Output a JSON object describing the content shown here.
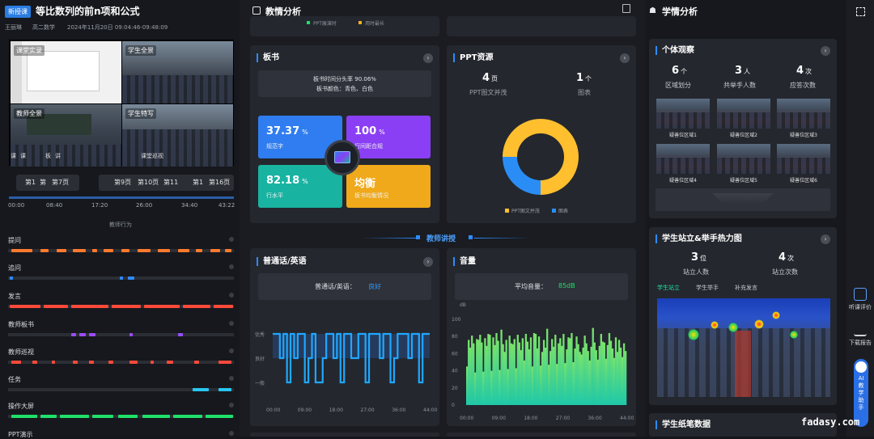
{
  "lesson": {
    "badge": "新授课",
    "title": "等比数列的前n项和公式",
    "teacher": "王丽琳",
    "grade_subject": "高二数学",
    "time": "2024年11月20日 09:04:46-09:48:09"
  },
  "videos": [
    {
      "label": "课堂实录"
    },
    {
      "label": "学生全景"
    },
    {
      "label": "教师全景"
    },
    {
      "label": "学生特写"
    }
  ],
  "video_controls": [
    "课",
    "课",
    "板",
    "讲",
    "课堂巡视"
  ],
  "page_tabs_a": [
    "第1",
    "第",
    "第7页"
  ],
  "page_tabs_b": [
    "第9页",
    "第10页",
    "第11",
    "第1",
    "第16页"
  ],
  "timeline": {
    "ticks": [
      "00:00",
      "08:40",
      "17:20",
      "26:00",
      "34:40",
      "43:22"
    ],
    "caption": "教师行为"
  },
  "behaviors": [
    {
      "label": "提问",
      "color": "#ff7a2e"
    },
    {
      "label": "追问",
      "color": "#2f8bff"
    },
    {
      "label": "发言",
      "color": "#ff4a3a"
    },
    {
      "label": "教师板书",
      "color": "#9b4dff"
    },
    {
      "label": "教师巡视",
      "color": "#ff4a3a"
    },
    {
      "label": "任务",
      "color": "#28c6ef"
    },
    {
      "label": "操作大屏",
      "color": "#1fe06a"
    },
    {
      "label": "PPT演示",
      "color": "#ffb020"
    }
  ],
  "teaching": {
    "header": "教情分析",
    "top_legend": [
      "PPT展演时",
      "用时最长"
    ],
    "board": {
      "title": "板书",
      "coverage_line": "板书时间分头率 90.06%",
      "color_line": "板书颜色：青色、白色",
      "tiles": [
        {
          "value": "37.37",
          "unit": "%",
          "label": "规范字",
          "color": "#2f7df0"
        },
        {
          "value": "100",
          "unit": "%",
          "label": "行间距合规",
          "color": "#8b3ff5"
        },
        {
          "value": "82.18",
          "unit": "%",
          "label": "行水平",
          "color": "#19b3a2"
        },
        {
          "value": "均衡",
          "unit": "",
          "label": "板书均衡情况",
          "color": "#f0a91a"
        }
      ]
    },
    "ppt": {
      "title": "PPT资源",
      "stats": [
        {
          "value": "4",
          "unit": "页",
          "label": "PPT图文并茂"
        },
        {
          "value": "1",
          "unit": "个",
          "label": "图表"
        }
      ],
      "donut": {
        "图文并茂": 75,
        "图表": 25
      },
      "legend": [
        "PPT图文并茂",
        "图表"
      ],
      "colors": [
        "#ffbf2e",
        "#2a8df5"
      ]
    },
    "section_label": "教师讲授",
    "mandarin": {
      "title": "普通话/英语",
      "result_prefix": "普通话/英语：",
      "result": "良好",
      "levels": [
        "优秀",
        "良好",
        "一般"
      ],
      "ticks": [
        "00:00",
        "09:00",
        "18:00",
        "27:00",
        "36:00",
        "44:00"
      ]
    },
    "volume": {
      "title": "音量",
      "avg_prefix": "平均音量：",
      "avg": "85dB",
      "unit": "dB",
      "y_ticks": [
        "100",
        "80",
        "60",
        "40",
        "20",
        "0"
      ],
      "ticks": [
        "00:00",
        "09:00",
        "18:00",
        "27:00",
        "36:00",
        "44:00"
      ]
    }
  },
  "learning": {
    "header": "学情分析",
    "individual": {
      "title": "个体观察",
      "stats": [
        {
          "value": "6",
          "unit": "个",
          "label": "区域划分"
        },
        {
          "value": "3",
          "unit": "人",
          "label": "共举手人数"
        },
        {
          "value": "4",
          "unit": "次",
          "label": "应答次数"
        }
      ],
      "zones": [
        "疑善位区域1",
        "疑善位区域2",
        "疑善位区域3",
        "疑善位区域4",
        "疑善位区域5",
        "疑善位区域6"
      ]
    },
    "heatmap": {
      "title": "学生站立&举手热力图",
      "stats": [
        {
          "value": "3",
          "unit": "位",
          "label": "站立人数"
        },
        {
          "value": "4",
          "unit": "次",
          "label": "站立次数"
        }
      ],
      "tabs": [
        "学生站立",
        "学生举手",
        "补充发言"
      ]
    },
    "notes_title": "学生纸笔数据"
  },
  "sidebar": [
    {
      "label": "听课评价",
      "icon": "edit-icon"
    },
    {
      "label": "下载报告",
      "icon": "download-icon"
    },
    {
      "label": "AI教学助手",
      "icon": "ai-assistant-icon"
    }
  ],
  "watermark": "fadasy.com"
}
